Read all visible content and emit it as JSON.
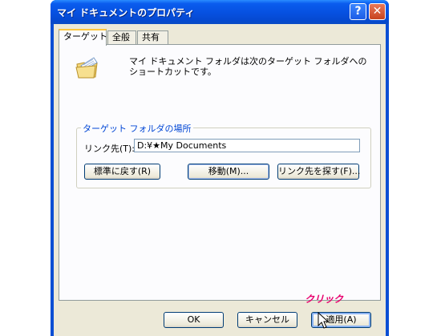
{
  "window": {
    "title": "マイ ドキュメントのプロパティ",
    "help_label": "?",
    "close_label": "✕"
  },
  "tabs": [
    {
      "label": "ターゲット",
      "active": true
    },
    {
      "label": "全般",
      "active": false
    },
    {
      "label": "共有",
      "active": false
    }
  ],
  "target": {
    "description": "マイ ドキュメント フォルダは次のターゲット フォルダへのショートカットです。",
    "group_label": "ターゲット フォルダの場所",
    "link_label": "リンク先(T):",
    "link_value": "D:¥★My Documents",
    "restore_label": "標準に戻す(R)",
    "move_label": "移動(M)...",
    "find_label": "リンク先を探す(F)..."
  },
  "footer": {
    "ok_label": "OK",
    "cancel_label": "キャンセル",
    "apply_label": "適用(A)"
  },
  "annotation": {
    "callout": "クリック"
  },
  "colors": {
    "titlebar": "#0650e0",
    "dialog_bg": "#ece9d8",
    "callout": "#e8006e",
    "group_label": "#0046d5"
  },
  "icons": {
    "document_folder": "my-documents-folder-icon",
    "cursor": "mouse-cursor-icon"
  }
}
